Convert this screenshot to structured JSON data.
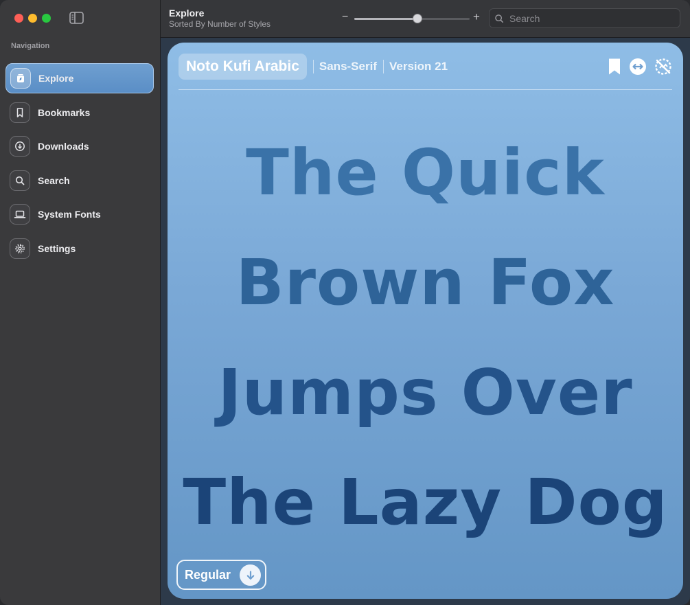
{
  "sidebar": {
    "heading": "Navigation",
    "items": [
      {
        "label": "Explore",
        "icon": "explore-icon",
        "active": true
      },
      {
        "label": "Bookmarks",
        "icon": "bookmark-icon",
        "active": false
      },
      {
        "label": "Downloads",
        "icon": "download-icon",
        "active": false
      },
      {
        "label": "Search",
        "icon": "search-icon",
        "active": false
      },
      {
        "label": "System Fonts",
        "icon": "laptop-icon",
        "active": false
      },
      {
        "label": "Settings",
        "icon": "gear-icon",
        "active": false
      }
    ]
  },
  "toolbar": {
    "title": "Explore",
    "subtitle": "Sorted By Number of Styles",
    "zoom_minus": "−",
    "zoom_plus": "+",
    "zoom_level": 0.55,
    "search_placeholder": "Search"
  },
  "card": {
    "font_name": "Noto Kufi Arabic",
    "category": "Sans-Serif",
    "version": "Version 21",
    "specimen_lines": [
      "The Quick",
      "Brown Fox",
      "Jumps Over",
      "The Lazy Dog"
    ],
    "style_label": "Regular",
    "actions": [
      "bookmark-icon",
      "expand-horizontal-icon",
      "hide-icon"
    ]
  },
  "colors": {
    "accent": "#5a8ec6",
    "card_top": "#8fbde6",
    "card_bottom": "#6496c6"
  }
}
